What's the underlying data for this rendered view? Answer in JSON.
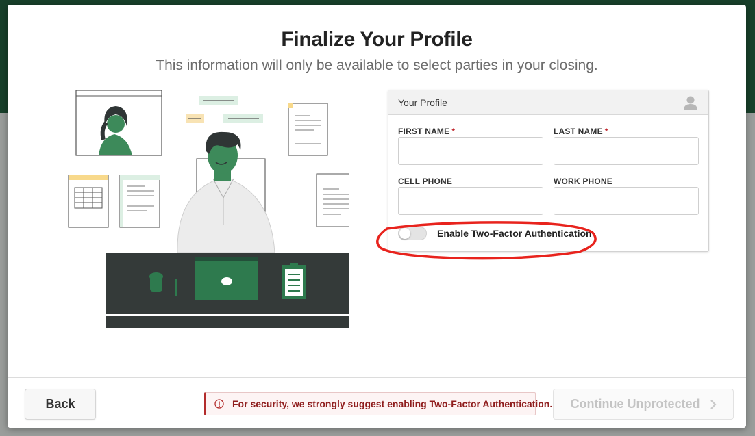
{
  "modal": {
    "title": "Finalize Your Profile",
    "subtitle": "This information will only be available to select parties in your closing."
  },
  "profile_card": {
    "title": "Your Profile",
    "header_icon": "user-silhouette-icon",
    "fields": {
      "first_name": {
        "label": "FIRST NAME",
        "required_marker": "*",
        "value": "",
        "placeholder": ""
      },
      "last_name": {
        "label": "LAST NAME",
        "required_marker": "*",
        "value": "",
        "placeholder": ""
      },
      "cell_phone": {
        "label": "CELL PHONE",
        "value": "",
        "placeholder": ""
      },
      "work_phone": {
        "label": "WORK PHONE",
        "value": "",
        "placeholder": ""
      }
    },
    "two_factor": {
      "label": "Enable Two-Factor Authentication",
      "enabled": false
    }
  },
  "annotation": {
    "color": "#e8231d",
    "shape": "oval highlight around two-factor toggle"
  },
  "footer": {
    "back_label": "Back",
    "warning_text": "For security, we strongly suggest enabling Two-Factor Authentication.",
    "warning_icon": "info-circle-icon",
    "continue_label": "Continue Unprotected",
    "continue_icon": "chevron-right-icon",
    "continue_disabled": true
  },
  "colors": {
    "brand_dark_green": "#18402a",
    "illustration_green": "#3d8a5a",
    "warning_red": "#8f1d1d",
    "required_red": "#c0272d"
  }
}
